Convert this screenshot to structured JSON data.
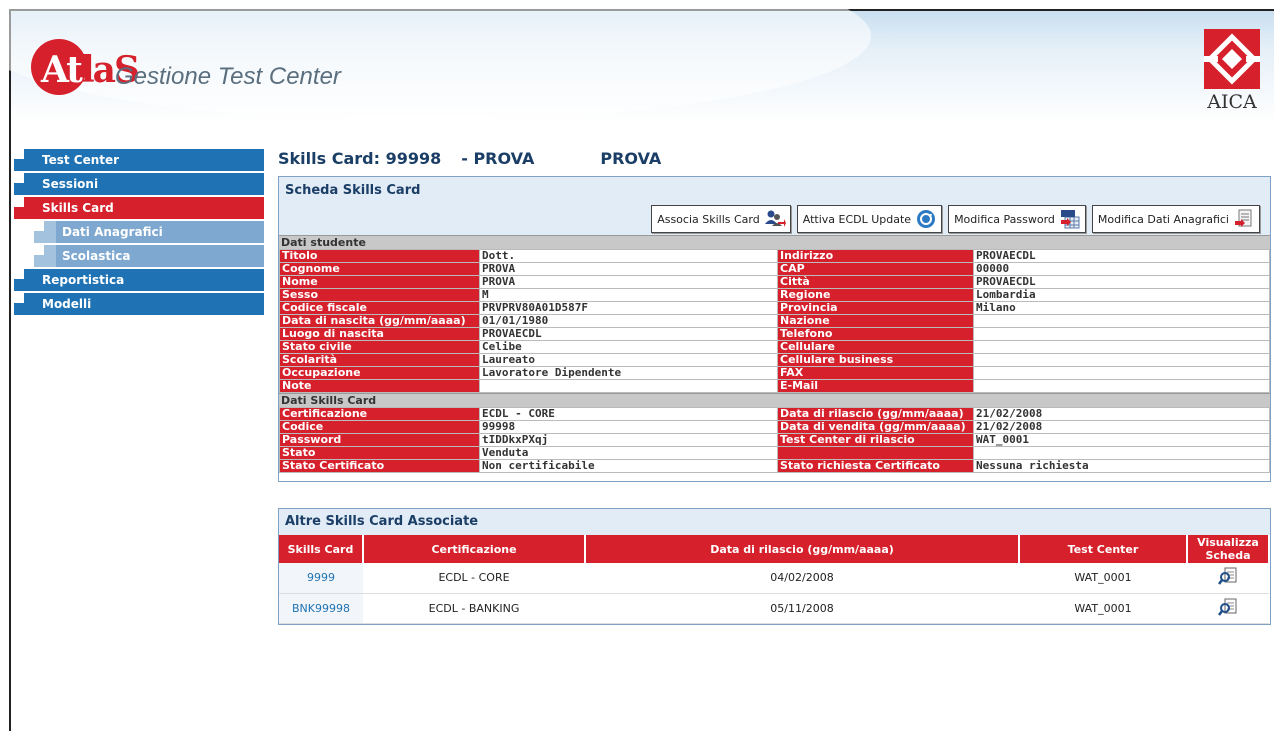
{
  "header": {
    "logo_main": "At",
    "logo_tail": "la",
    "logo_s": "S",
    "app_title": "Gestione Test Center",
    "partner_logo": "AICA"
  },
  "sidebar": {
    "items": [
      {
        "label": "Test Center"
      },
      {
        "label": "Sessioni"
      },
      {
        "label": "Skills Card"
      },
      {
        "label": "Dati Anagrafici"
      },
      {
        "label": "Scolastica"
      },
      {
        "label": "Reportistica"
      },
      {
        "label": "Modelli"
      }
    ]
  },
  "page": {
    "title_prefix": "Skills Card: 99998",
    "title_name": "- PROVA",
    "title_surname": "PROVA"
  },
  "scheda": {
    "title": "Scheda Skills Card",
    "buttons": {
      "associa": "Associa Skills Card",
      "attiva": "Attiva ECDL Update",
      "password": "Modifica Password",
      "anagrafici": "Modifica Dati Anagrafici"
    },
    "student_section": "Dati studente",
    "student_rows": [
      {
        "k1": "Titolo",
        "v1": "Dott.",
        "k2": "Indirizzo",
        "v2": "PROVAECDL"
      },
      {
        "k1": "Cognome",
        "v1": "PROVA",
        "k2": "CAP",
        "v2": "00000"
      },
      {
        "k1": "Nome",
        "v1": "PROVA",
        "k2": "Città",
        "v2": "PROVAECDL"
      },
      {
        "k1": "Sesso",
        "v1": "M",
        "k2": "Regione",
        "v2": "Lombardia"
      },
      {
        "k1": "Codice fiscale",
        "v1": "PRVPRV80A01D587F",
        "k2": "Provincia",
        "v2": "Milano"
      },
      {
        "k1": "Data di nascita (gg/mm/aaaa)",
        "v1": "01/01/1980",
        "k2": "Nazione",
        "v2": ""
      },
      {
        "k1": "Luogo di nascita",
        "v1": "PROVAECDL",
        "k2": "Telefono",
        "v2": ""
      },
      {
        "k1": "Stato civile",
        "v1": "Celibe",
        "k2": "Cellulare",
        "v2": ""
      },
      {
        "k1": "Scolarità",
        "v1": "Laureato",
        "k2": "Cellulare business",
        "v2": ""
      },
      {
        "k1": "Occupazione",
        "v1": "Lavoratore Dipendente",
        "k2": "FAX",
        "v2": ""
      },
      {
        "k1": "Note",
        "v1": "",
        "k2": "E-Mail",
        "v2": ""
      }
    ],
    "card_section": "Dati Skills Card",
    "card_rows": [
      {
        "k1": "Certificazione",
        "v1": "ECDL - CORE",
        "k2": "Data di rilascio (gg/mm/aaaa)",
        "v2": "21/02/2008"
      },
      {
        "k1": "Codice",
        "v1": "99998",
        "k2": "Data di vendita (gg/mm/aaaa)",
        "v2": "21/02/2008"
      },
      {
        "k1": "Password",
        "v1": "tIDDkxPXqj",
        "k2": "Test Center di rilascio",
        "v2": "WAT_0001"
      },
      {
        "k1": "Stato",
        "v1": "Venduta",
        "k2": "",
        "v2": ""
      },
      {
        "k1": "Stato Certificato",
        "v1": "Non certificabile",
        "k2": "Stato richiesta Certificato",
        "v2": "Nessuna richiesta"
      }
    ]
  },
  "associate": {
    "title": "Altre Skills Card Associate",
    "columns": [
      "Skills Card",
      "Certificazione",
      "Data di rilascio (gg/mm/aaaa)",
      "Test Center",
      "Visualizza Scheda"
    ],
    "rows": [
      {
        "card": "9999",
        "cert": "ECDL - CORE",
        "date": "04/02/2008",
        "tc": "WAT_0001"
      },
      {
        "card": "BNK99998",
        "cert": "ECDL - BANKING",
        "date": "05/11/2008",
        "tc": "WAT_0001"
      }
    ]
  },
  "colors": {
    "brand_red": "#d6202c",
    "nav_blue": "#1f73b4",
    "title_blue": "#1b3e66"
  }
}
